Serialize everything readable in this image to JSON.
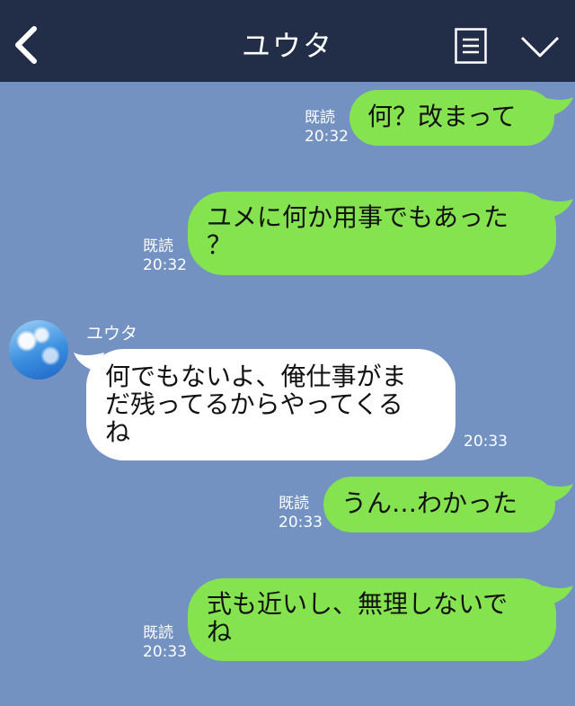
{
  "header": {
    "title": "ユウタ",
    "back_icon": "chevron-left-icon",
    "menu_icon": "menu-icon",
    "collapse_icon": "chevron-down-icon"
  },
  "colors": {
    "background": "#7392c2",
    "header": "#222d48",
    "sent_bubble": "#84e34f",
    "received_bubble": "#ffffff"
  },
  "messages": [
    {
      "direction": "sent",
      "lines": [
        "何？改まって"
      ],
      "read_label": "既読",
      "time": "20:32"
    },
    {
      "direction": "sent",
      "lines": [
        "ユメに何か用事でもあった",
        "？"
      ],
      "read_label": "既読",
      "time": "20:32"
    },
    {
      "direction": "received",
      "sender": "ユウタ",
      "lines": [
        "何でもないよ、俺仕事がま",
        "だ残ってるからやってくる",
        "ね"
      ],
      "time": "20:33"
    },
    {
      "direction": "sent",
      "lines": [
        "うん…わかった"
      ],
      "read_label": "既読",
      "time": "20:33"
    },
    {
      "direction": "sent",
      "lines": [
        "式も近いし、無理しないで",
        "ね"
      ],
      "read_label": "既読",
      "time": "20:33"
    }
  ]
}
